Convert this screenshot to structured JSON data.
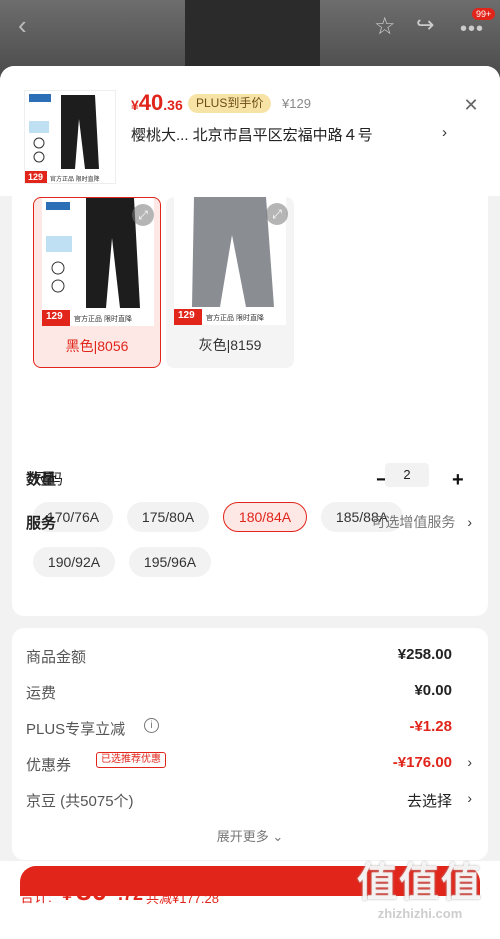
{
  "background": {
    "badge": "99+"
  },
  "header": {
    "price_symbol": "¥",
    "price_int": "40",
    "price_dec": ".36",
    "plus_tag": "PLUS到手价",
    "original_price": "¥129",
    "address": "樱桃大...  北京市昌平区宏福中路４号",
    "thumb_badge": "129",
    "thumb_strip": "官方正品 限时直降"
  },
  "colors": {
    "items": [
      {
        "label": "黑色|8056",
        "selected": true,
        "badge": "129",
        "strip": "官方正品 限时直降"
      },
      {
        "label": "灰色|8159",
        "selected": false,
        "badge": "129",
        "strip": "官方正品 限时直降"
      }
    ]
  },
  "size": {
    "title": "尺码",
    "options": [
      "170/76A",
      "175/80A",
      "180/84A",
      "185/88A",
      "190/92A",
      "195/96A"
    ],
    "selected": "180/84A"
  },
  "quantity": {
    "label": "数量",
    "value": "2"
  },
  "service": {
    "label": "服务",
    "value": "可选增值服务"
  },
  "summary": {
    "goods_label": "商品金额",
    "goods_value": "¥258.00",
    "shipping_label": "运费",
    "shipping_value": "¥0.00",
    "plus_label": "PLUS专享立减",
    "plus_value": "-¥1.28",
    "coupon_label": "优惠券",
    "coupon_tag": "已选推荐优惠",
    "coupon_value": "-¥176.00",
    "beans_label": "京豆 (共5075个)",
    "beans_value": "去选择",
    "expand": "展开更多 ⌄"
  },
  "footer": {
    "total_label": "合计:",
    "total_symbol": "¥",
    "total_int": "80",
    "total_dec": ".72",
    "saved": "共减¥177.28"
  },
  "watermark": {
    "big": "值值值",
    "small": "zhizhizhi.com"
  },
  "colors_palette": {
    "accent": "#e1251b",
    "plus_gold": "#f8e3a7",
    "sheet_bg": "#f2f2f2"
  }
}
